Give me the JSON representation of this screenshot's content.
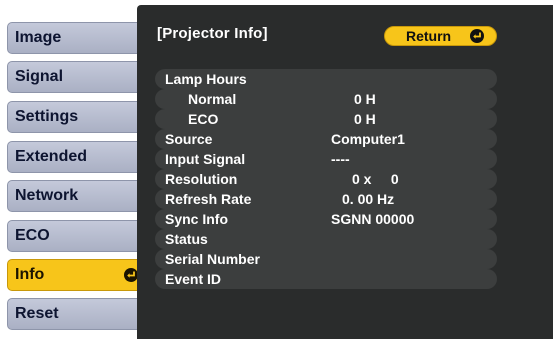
{
  "sidebar": {
    "items": [
      {
        "label": "Image"
      },
      {
        "label": "Signal"
      },
      {
        "label": "Settings"
      },
      {
        "label": "Extended"
      },
      {
        "label": "Network"
      },
      {
        "label": "ECO"
      },
      {
        "label": "Info",
        "active": true
      },
      {
        "label": "Reset"
      }
    ]
  },
  "panel": {
    "title": "[Projector Info]",
    "return_label": "Return"
  },
  "info": {
    "lamp_hours": {
      "label": "Lamp Hours"
    },
    "normal": {
      "label": "Normal",
      "value": "0 H"
    },
    "eco": {
      "label": "ECO",
      "value": "0 H"
    },
    "source": {
      "label": "Source",
      "value": "Computer1"
    },
    "input_signal": {
      "label": "Input Signal",
      "value": "----"
    },
    "resolution": {
      "label": "Resolution",
      "value": "0 x     0"
    },
    "refresh_rate": {
      "label": "Refresh Rate",
      "value": "0. 00 Hz"
    },
    "sync_info": {
      "label": "Sync Info",
      "value": "SGNN 00000"
    },
    "status": {
      "label": "Status"
    },
    "serial_number": {
      "label": "Serial Number"
    },
    "event_id": {
      "label": "Event ID"
    }
  },
  "colors": {
    "menu_bg": "#b7bccd",
    "menu_active": "#f7c51a",
    "panel_bg": "#2a2c2c",
    "row_bg": "#3c3e3e",
    "text_light": "#ffffff"
  },
  "icons": {
    "enter": "enter-icon"
  }
}
